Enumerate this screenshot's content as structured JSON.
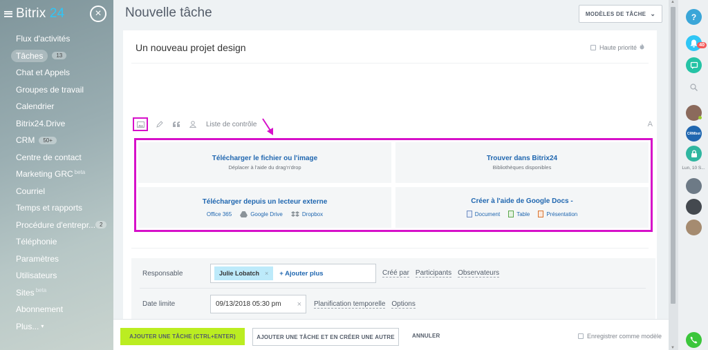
{
  "sidebar": {
    "logo_brand": "Bitrix",
    "logo_num": "24",
    "items": [
      {
        "label": "Flux d'activités"
      },
      {
        "label": "Tâches",
        "badge": "13"
      },
      {
        "label": "Chat et Appels"
      },
      {
        "label": "Groupes de travail"
      },
      {
        "label": "Calendrier"
      },
      {
        "label": "Bitrix24.Drive"
      },
      {
        "label": "CRM",
        "badge": "50+"
      },
      {
        "label": "Centre de contact"
      },
      {
        "label": "Marketing GRC",
        "sup": "beta"
      },
      {
        "label": "Courriel"
      },
      {
        "label": "Temps et rapports"
      },
      {
        "label": "Procédure d'entrepr...",
        "badge": "2"
      },
      {
        "label": "Téléphonie"
      },
      {
        "label": "Paramètres"
      },
      {
        "label": "Utilisateurs"
      },
      {
        "label": "Sites",
        "sup": "beta"
      },
      {
        "label": "Abonnement"
      },
      {
        "label": "Plus...",
        "caret": "▾"
      }
    ]
  },
  "close_glyph": "×",
  "page_title": "Nouvelle tâche",
  "templates_button": {
    "label": "MODÈLES DE TÂCHE",
    "chevron": "⌄"
  },
  "task": {
    "name": "Un nouveau projet design",
    "priority_label": "Haute priorité"
  },
  "toolbar": {
    "checklist_label": "Liste de contrôle",
    "font_glyph": "A"
  },
  "upload": {
    "cells": [
      {
        "title": "Télécharger le fichier ou l'image",
        "subtitle": "Déplacer à l'aide du drag'n'drop"
      },
      {
        "title": "Trouver dans Bitrix24",
        "subtitle": "Bibliothèques disponibles"
      },
      {
        "title": "Télécharger depuis un lecteur externe",
        "links": [
          "Office 365",
          "Google Drive",
          "Dropbox"
        ]
      },
      {
        "title": "Créer à l'aide de Google Docs -",
        "links": [
          "Document",
          "Table",
          "Présentation"
        ]
      }
    ]
  },
  "fields": {
    "responsible_label": "Responsable",
    "responsible_chip": "Julie Lobatch",
    "chip_remove": "×",
    "add_more": "+ Ajouter plus",
    "role_links": [
      "Créé par",
      "Participants",
      "Observateurs"
    ],
    "deadline_label": "Date limite",
    "deadline_value": "09/13/2018 05:30 pm",
    "deadline_clear": "×",
    "deadline_links": [
      "Planification temporelle",
      "Options"
    ]
  },
  "footer": {
    "add_task": "AJOUTER UNE TÂCHE (CTRL+ENTER)",
    "add_and_new": "AJOUTER UNE TÂCHE ET EN CRÉER UNE AUTRE",
    "cancel": "ANNULER",
    "save_template": "Enregistrer comme modèle"
  },
  "rightbar": {
    "help": "?",
    "notifications_badge": "40",
    "date_label": "Lun, 10 S...",
    "bot_label": "CRMbot"
  },
  "colors": {
    "highlight": "#d610c9",
    "accent_blue": "#2067b0",
    "add_button": "#bbed21"
  }
}
